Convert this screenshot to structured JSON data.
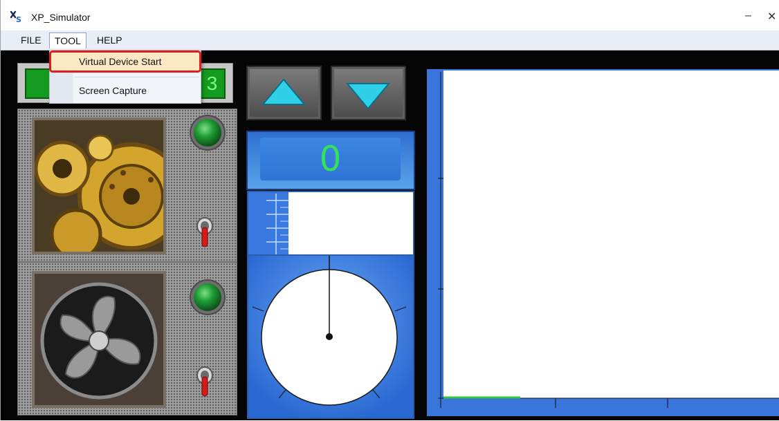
{
  "window": {
    "title": "XP_Simulator",
    "minimize_glyph": "–",
    "close_glyph": "✕"
  },
  "menu": {
    "items": [
      "FILE",
      "TOOL",
      "HELP"
    ],
    "open_menu": "TOOL"
  },
  "dropdown": {
    "items": [
      "Virtual Device Start",
      "Screen Capture"
    ],
    "highlighted": "Virtual Device Start"
  },
  "status_display": {
    "right_digit": "3"
  },
  "counter": {
    "value": "0"
  },
  "icons": {
    "app": "xp-simulator-logo-icon",
    "up": "up-arrow-icon",
    "down": "down-arrow-icon",
    "fan": "fan-icon",
    "gears": "gears-icon"
  },
  "colors": {
    "accent_blue": "#3a75db",
    "counter_text": "#35e15a",
    "indicator_green": "#1f9b34",
    "highlight_outline": "#e01d1d",
    "highlight_fill": "#fde8c4"
  }
}
